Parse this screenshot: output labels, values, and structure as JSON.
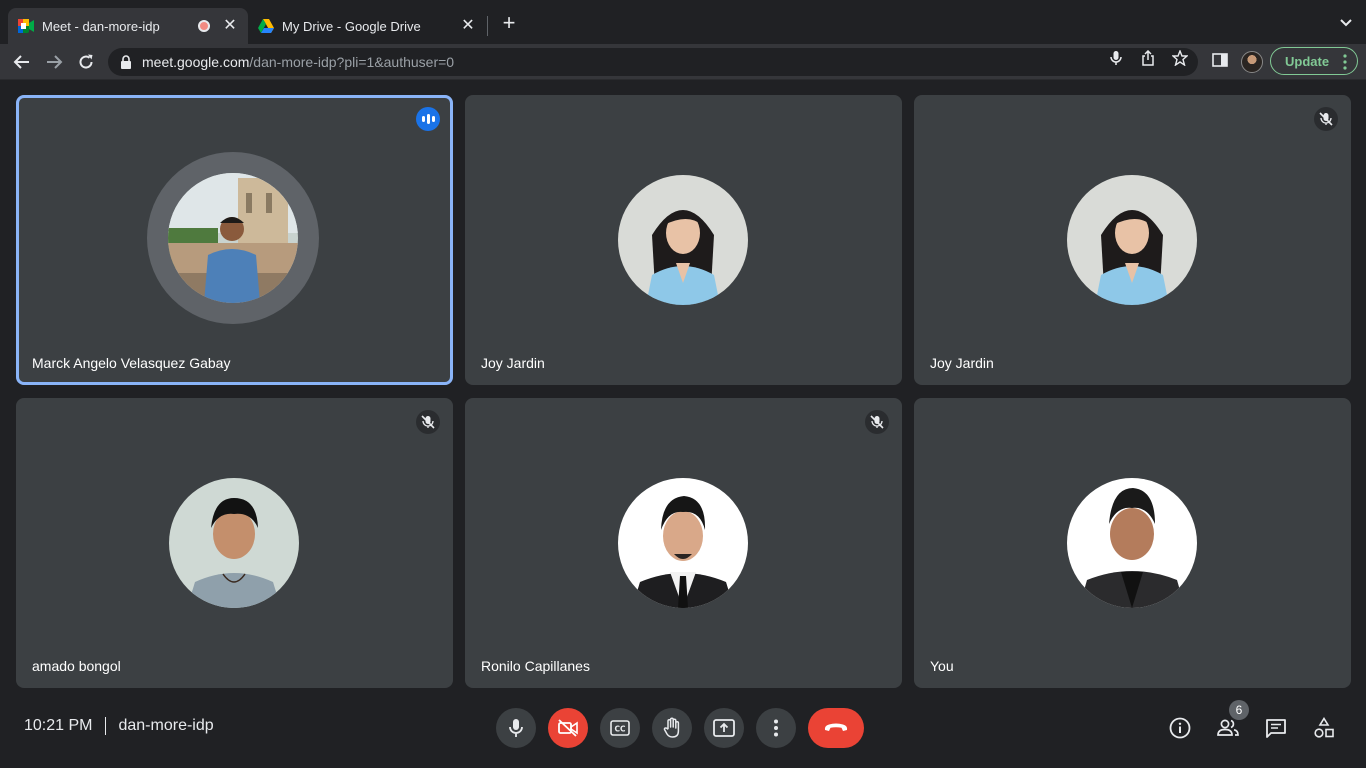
{
  "browser": {
    "tabs": [
      {
        "title": "Meet - dan-more-idp",
        "active": true,
        "recording": true
      },
      {
        "title": "My Drive - Google Drive",
        "active": false
      }
    ],
    "url_host": "meet.google.com",
    "url_path": "/dan-more-idp?pli=1&authuser=0",
    "update_label": "Update",
    "accent": "#81c995"
  },
  "participants": [
    {
      "name": "Marck Angelo Velasquez Gabay",
      "state": "speaking"
    },
    {
      "name": "Joy Jardin",
      "state": "unmuted"
    },
    {
      "name": "Joy Jardin",
      "state": "muted"
    },
    {
      "name": "amado bongol",
      "state": "muted"
    },
    {
      "name": "Ronilo Capillanes",
      "state": "muted"
    },
    {
      "name": "You",
      "state": "unmuted"
    }
  ],
  "meeting": {
    "time": "10:21 PM",
    "code": "dan-more-idp",
    "people_count": "6"
  },
  "controls": [
    "mic-icon",
    "camera-off-icon",
    "captions-icon",
    "raise-hand-icon",
    "present-screen-icon",
    "more-options-icon",
    "hang-up-icon"
  ],
  "side_controls": [
    "info-icon",
    "people-icon",
    "chat-icon",
    "activities-icon"
  ],
  "colors": {
    "speaking_outline": "#8ab4f8",
    "danger": "#ea4335",
    "tile": "#3c4043",
    "background": "#202124"
  }
}
